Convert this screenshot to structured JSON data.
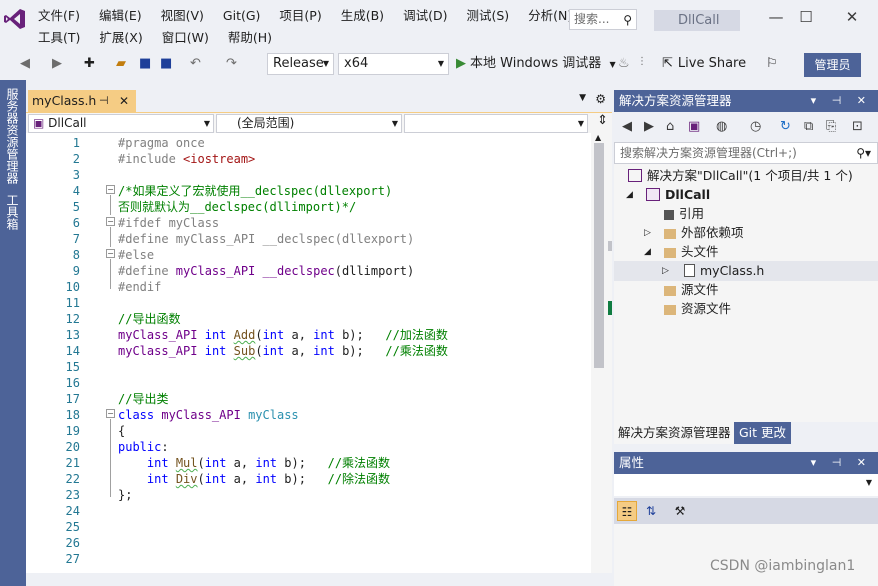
{
  "menu": {
    "row1": [
      "文件(F)",
      "编辑(E)",
      "视图(V)",
      "Git(G)",
      "项目(P)",
      "生成(B)",
      "调试(D)",
      "测试(S)",
      "分析(N)"
    ],
    "row2": [
      "工具(T)",
      "扩展(X)",
      "窗口(W)",
      "帮助(H)"
    ]
  },
  "search": {
    "placeholder": "搜索..."
  },
  "solution_badge": "DllCall",
  "toolbar": {
    "configuration": "Release",
    "platform": "x64",
    "run_label": "本地 Windows 调试器",
    "liveshare_label": "Live Share",
    "admin_label": "管理员"
  },
  "left_strip": {
    "tab1": "服务器资源管理器",
    "tab2": "工具箱"
  },
  "editor": {
    "tab_title": "myClass.h",
    "nav_project": "DllCall",
    "nav_scope": "(全局范围)",
    "nav_member": "",
    "line_numbers": [
      "1",
      "2",
      "3",
      "4",
      "5",
      "6",
      "7",
      "8",
      "9",
      "10",
      "11",
      "12",
      "13",
      "14",
      "15",
      "16",
      "17",
      "18",
      "19",
      "20",
      "21",
      "22",
      "23",
      "24",
      "25",
      "26",
      "27"
    ]
  },
  "solution_explorer": {
    "title": "解决方案资源管理器",
    "search_placeholder": "搜索解决方案资源管理器(Ctrl+;)",
    "solution_label": "解决方案\"DllCall\"(1 个项目/共 1 个)",
    "project": "DllCall",
    "nodes": {
      "references": "引用",
      "external": "外部依赖项",
      "headers": "头文件",
      "header_file": "myClass.h",
      "sources": "源文件",
      "resources": "资源文件"
    },
    "tab_active": "解决方案资源管理器",
    "tab_git": "Git 更改"
  },
  "properties": {
    "title": "属性"
  },
  "watermark": "CSDN @iambinglan1",
  "colors": {
    "accent": "#4d6398",
    "tab_active": "#f5cc84",
    "background": "#eef0f5"
  }
}
